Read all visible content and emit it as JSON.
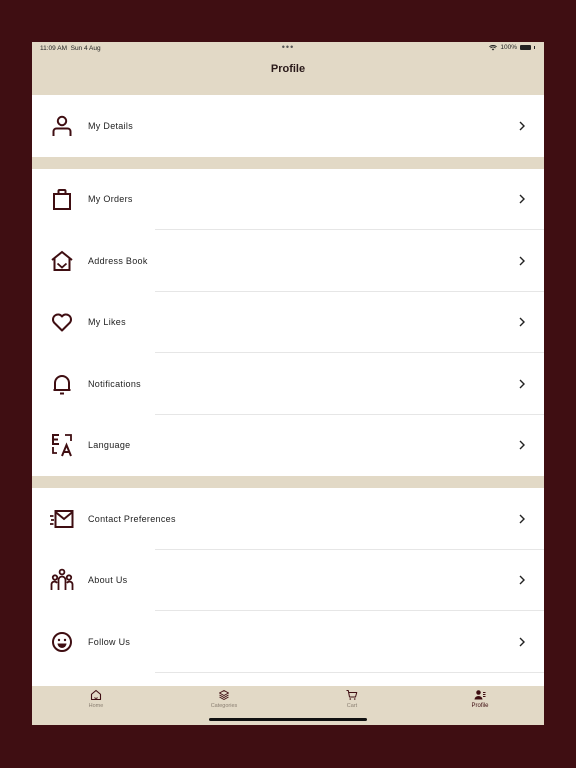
{
  "status": {
    "time": "11:09 AM",
    "date": "Sun 4 Aug",
    "dots": "•••",
    "battery": "100%"
  },
  "header": {
    "title": "Profile"
  },
  "sections": [
    {
      "items": [
        {
          "label": "My Details",
          "icon": "person-icon"
        }
      ]
    },
    {
      "items": [
        {
          "label": "My Orders",
          "icon": "bag-icon"
        },
        {
          "label": "Address Book",
          "icon": "home-heart-icon"
        },
        {
          "label": "My Likes",
          "icon": "heart-icon"
        },
        {
          "label": "Notifications",
          "icon": "bell-icon"
        },
        {
          "label": "Language",
          "icon": "language-icon"
        }
      ]
    },
    {
      "items": [
        {
          "label": "Contact Preferences",
          "icon": "mail-icon"
        },
        {
          "label": "About Us",
          "icon": "group-icon"
        },
        {
          "label": "Follow Us",
          "icon": "smile-icon"
        }
      ]
    }
  ],
  "tabs": [
    {
      "label": "Home",
      "icon": "home-icon"
    },
    {
      "label": "Categories",
      "icon": "layers-icon"
    },
    {
      "label": "Cart",
      "icon": "cart-icon"
    },
    {
      "label": "Profile",
      "icon": "profile-icon",
      "active": true
    }
  ],
  "colors": {
    "brand": "#3f0e12",
    "beige": "#e2d9c6"
  }
}
